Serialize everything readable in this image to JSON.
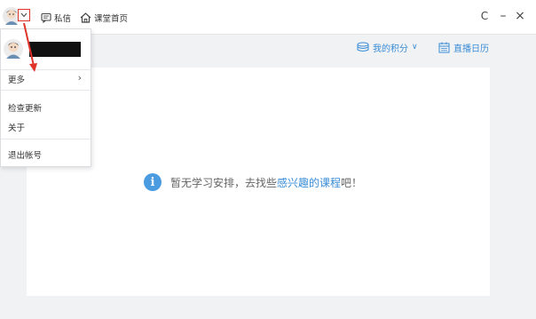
{
  "titlebar": {
    "messages_label": "私信",
    "home_label": "课堂首页",
    "refresh_symbol": "C",
    "minimize_symbol": "–",
    "close_symbol": "×"
  },
  "main": {
    "points_label": "我的积分",
    "points_chevron": "∨",
    "calendar_label": "直播日历",
    "empty_text_before": "暂无学习安排，去找些",
    "empty_text_link": "感兴趣的课程",
    "empty_text_after": "吧！",
    "info_symbol": "i"
  },
  "menu": {
    "items": [
      {
        "label": "更多",
        "chevron": "›"
      },
      {
        "label": "检查更新"
      },
      {
        "label": "关于"
      },
      {
        "label": "退出帐号"
      }
    ]
  },
  "colors": {
    "accent": "#3a8cd6",
    "annotation_red": "#e0342b",
    "background": "#f1f2f4"
  },
  "icons": [
    "avatar",
    "chevron-down-icon",
    "message-icon",
    "home-icon",
    "refresh-icon",
    "minimize-icon",
    "close-icon",
    "coins-icon",
    "calendar-icon",
    "info-icon",
    "annotation-arrow"
  ]
}
